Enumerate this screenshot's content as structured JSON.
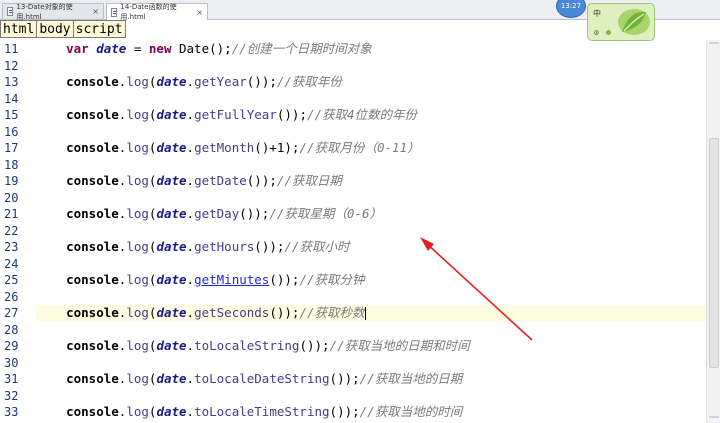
{
  "tabs": [
    {
      "label": "13-Date对象的使用.html",
      "close": "×",
      "active": false
    },
    {
      "label": "14-Date函数的使用.html",
      "close": "×",
      "active": true
    }
  ],
  "breadcrumb": [
    "html",
    "body",
    "script"
  ],
  "clock": "13:27",
  "ime": {
    "label": "中",
    "gear": "⚙"
  },
  "code_lines": [
    {
      "num": "11",
      "parts": [
        {
          "t": "    "
        },
        {
          "t": "var",
          "c": "kw"
        },
        {
          "t": " "
        },
        {
          "t": "date",
          "c": "var"
        },
        {
          "t": " = "
        },
        {
          "t": "new",
          "c": "kw"
        },
        {
          "t": " Date();"
        },
        {
          "t": "//创建一个日期时间对象",
          "c": "cm"
        }
      ]
    },
    {
      "num": "12",
      "parts": []
    },
    {
      "num": "13",
      "parts": [
        {
          "t": "    "
        },
        {
          "t": "console",
          "c": "obj"
        },
        {
          "t": "."
        },
        {
          "t": "log",
          "c": "fn"
        },
        {
          "t": "("
        },
        {
          "t": "date",
          "c": "var"
        },
        {
          "t": "."
        },
        {
          "t": "getYear",
          "c": "fn"
        },
        {
          "t": "());"
        },
        {
          "t": "//获取年份",
          "c": "cm"
        }
      ]
    },
    {
      "num": "14",
      "parts": []
    },
    {
      "num": "15",
      "parts": [
        {
          "t": "    "
        },
        {
          "t": "console",
          "c": "obj"
        },
        {
          "t": "."
        },
        {
          "t": "log",
          "c": "fn"
        },
        {
          "t": "("
        },
        {
          "t": "date",
          "c": "var"
        },
        {
          "t": "."
        },
        {
          "t": "getFullYear",
          "c": "fn"
        },
        {
          "t": "());"
        },
        {
          "t": "//获取4位数的年份",
          "c": "cm"
        }
      ]
    },
    {
      "num": "16",
      "parts": []
    },
    {
      "num": "17",
      "parts": [
        {
          "t": "    "
        },
        {
          "t": "console",
          "c": "obj"
        },
        {
          "t": "."
        },
        {
          "t": "log",
          "c": "fn"
        },
        {
          "t": "("
        },
        {
          "t": "date",
          "c": "var"
        },
        {
          "t": "."
        },
        {
          "t": "getMonth",
          "c": "fn"
        },
        {
          "t": "()+1);"
        },
        {
          "t": "//获取月份（0-11）",
          "c": "cm"
        }
      ]
    },
    {
      "num": "18",
      "parts": []
    },
    {
      "num": "19",
      "parts": [
        {
          "t": "    "
        },
        {
          "t": "console",
          "c": "obj"
        },
        {
          "t": "."
        },
        {
          "t": "log",
          "c": "fn"
        },
        {
          "t": "("
        },
        {
          "t": "date",
          "c": "var"
        },
        {
          "t": "."
        },
        {
          "t": "getDate",
          "c": "fn"
        },
        {
          "t": "());"
        },
        {
          "t": "//获取日期",
          "c": "cm"
        }
      ]
    },
    {
      "num": "20",
      "parts": []
    },
    {
      "num": "21",
      "parts": [
        {
          "t": "    "
        },
        {
          "t": "console",
          "c": "obj"
        },
        {
          "t": "."
        },
        {
          "t": "log",
          "c": "fn"
        },
        {
          "t": "("
        },
        {
          "t": "date",
          "c": "var"
        },
        {
          "t": "."
        },
        {
          "t": "getDay",
          "c": "fn"
        },
        {
          "t": "());"
        },
        {
          "t": "//获取星期（0-6）",
          "c": "cm"
        }
      ]
    },
    {
      "num": "22",
      "parts": []
    },
    {
      "num": "23",
      "parts": [
        {
          "t": "    "
        },
        {
          "t": "console",
          "c": "obj"
        },
        {
          "t": "."
        },
        {
          "t": "log",
          "c": "fn"
        },
        {
          "t": "("
        },
        {
          "t": "date",
          "c": "var"
        },
        {
          "t": "."
        },
        {
          "t": "getHours",
          "c": "fn"
        },
        {
          "t": "());"
        },
        {
          "t": "//获取小时",
          "c": "cm"
        }
      ]
    },
    {
      "num": "24",
      "parts": []
    },
    {
      "num": "25",
      "parts": [
        {
          "t": "    "
        },
        {
          "t": "console",
          "c": "obj"
        },
        {
          "t": "."
        },
        {
          "t": "log",
          "c": "fn"
        },
        {
          "t": "("
        },
        {
          "t": "date",
          "c": "var"
        },
        {
          "t": "."
        },
        {
          "t": "getMinutes",
          "c": "fn-link"
        },
        {
          "t": "());"
        },
        {
          "t": "//获取分钟",
          "c": "cm"
        }
      ]
    },
    {
      "num": "26",
      "parts": []
    },
    {
      "num": "27",
      "current": true,
      "parts": [
        {
          "t": "    "
        },
        {
          "t": "console",
          "c": "obj"
        },
        {
          "t": "."
        },
        {
          "t": "log",
          "c": "fn"
        },
        {
          "t": "("
        },
        {
          "t": "date",
          "c": "var"
        },
        {
          "t": "."
        },
        {
          "t": "getSeconds",
          "c": "fn"
        },
        {
          "t": "());"
        },
        {
          "t": "//获取秒数",
          "c": "cm"
        }
      ]
    },
    {
      "num": "28",
      "parts": []
    },
    {
      "num": "29",
      "parts": [
        {
          "t": "    "
        },
        {
          "t": "console",
          "c": "obj"
        },
        {
          "t": "."
        },
        {
          "t": "log",
          "c": "fn"
        },
        {
          "t": "("
        },
        {
          "t": "date",
          "c": "var"
        },
        {
          "t": "."
        },
        {
          "t": "toLocaleString",
          "c": "fn"
        },
        {
          "t": "());"
        },
        {
          "t": "//获取当地的日期和时间",
          "c": "cm"
        }
      ]
    },
    {
      "num": "30",
      "parts": []
    },
    {
      "num": "31",
      "parts": [
        {
          "t": "    "
        },
        {
          "t": "console",
          "c": "obj"
        },
        {
          "t": "."
        },
        {
          "t": "log",
          "c": "fn"
        },
        {
          "t": "("
        },
        {
          "t": "date",
          "c": "var"
        },
        {
          "t": "."
        },
        {
          "t": "toLocaleDateString",
          "c": "fn"
        },
        {
          "t": "());"
        },
        {
          "t": "//获取当地的日期",
          "c": "cm"
        }
      ]
    },
    {
      "num": "32",
      "parts": []
    },
    {
      "num": "33",
      "parts": [
        {
          "t": "    "
        },
        {
          "t": "console",
          "c": "obj"
        },
        {
          "t": "."
        },
        {
          "t": "log",
          "c": "fn"
        },
        {
          "t": "("
        },
        {
          "t": "date",
          "c": "var"
        },
        {
          "t": "."
        },
        {
          "t": "toLocaleTimeString",
          "c": "fn"
        },
        {
          "t": "());"
        },
        {
          "t": "//获取当地的时间",
          "c": "cm"
        }
      ]
    }
  ],
  "colors": {
    "keyword": "#7f0055",
    "comment": "#7a7a7a",
    "link": "#1a2ad8",
    "arrow": "#e02020",
    "current_line": "#fffbe0"
  }
}
